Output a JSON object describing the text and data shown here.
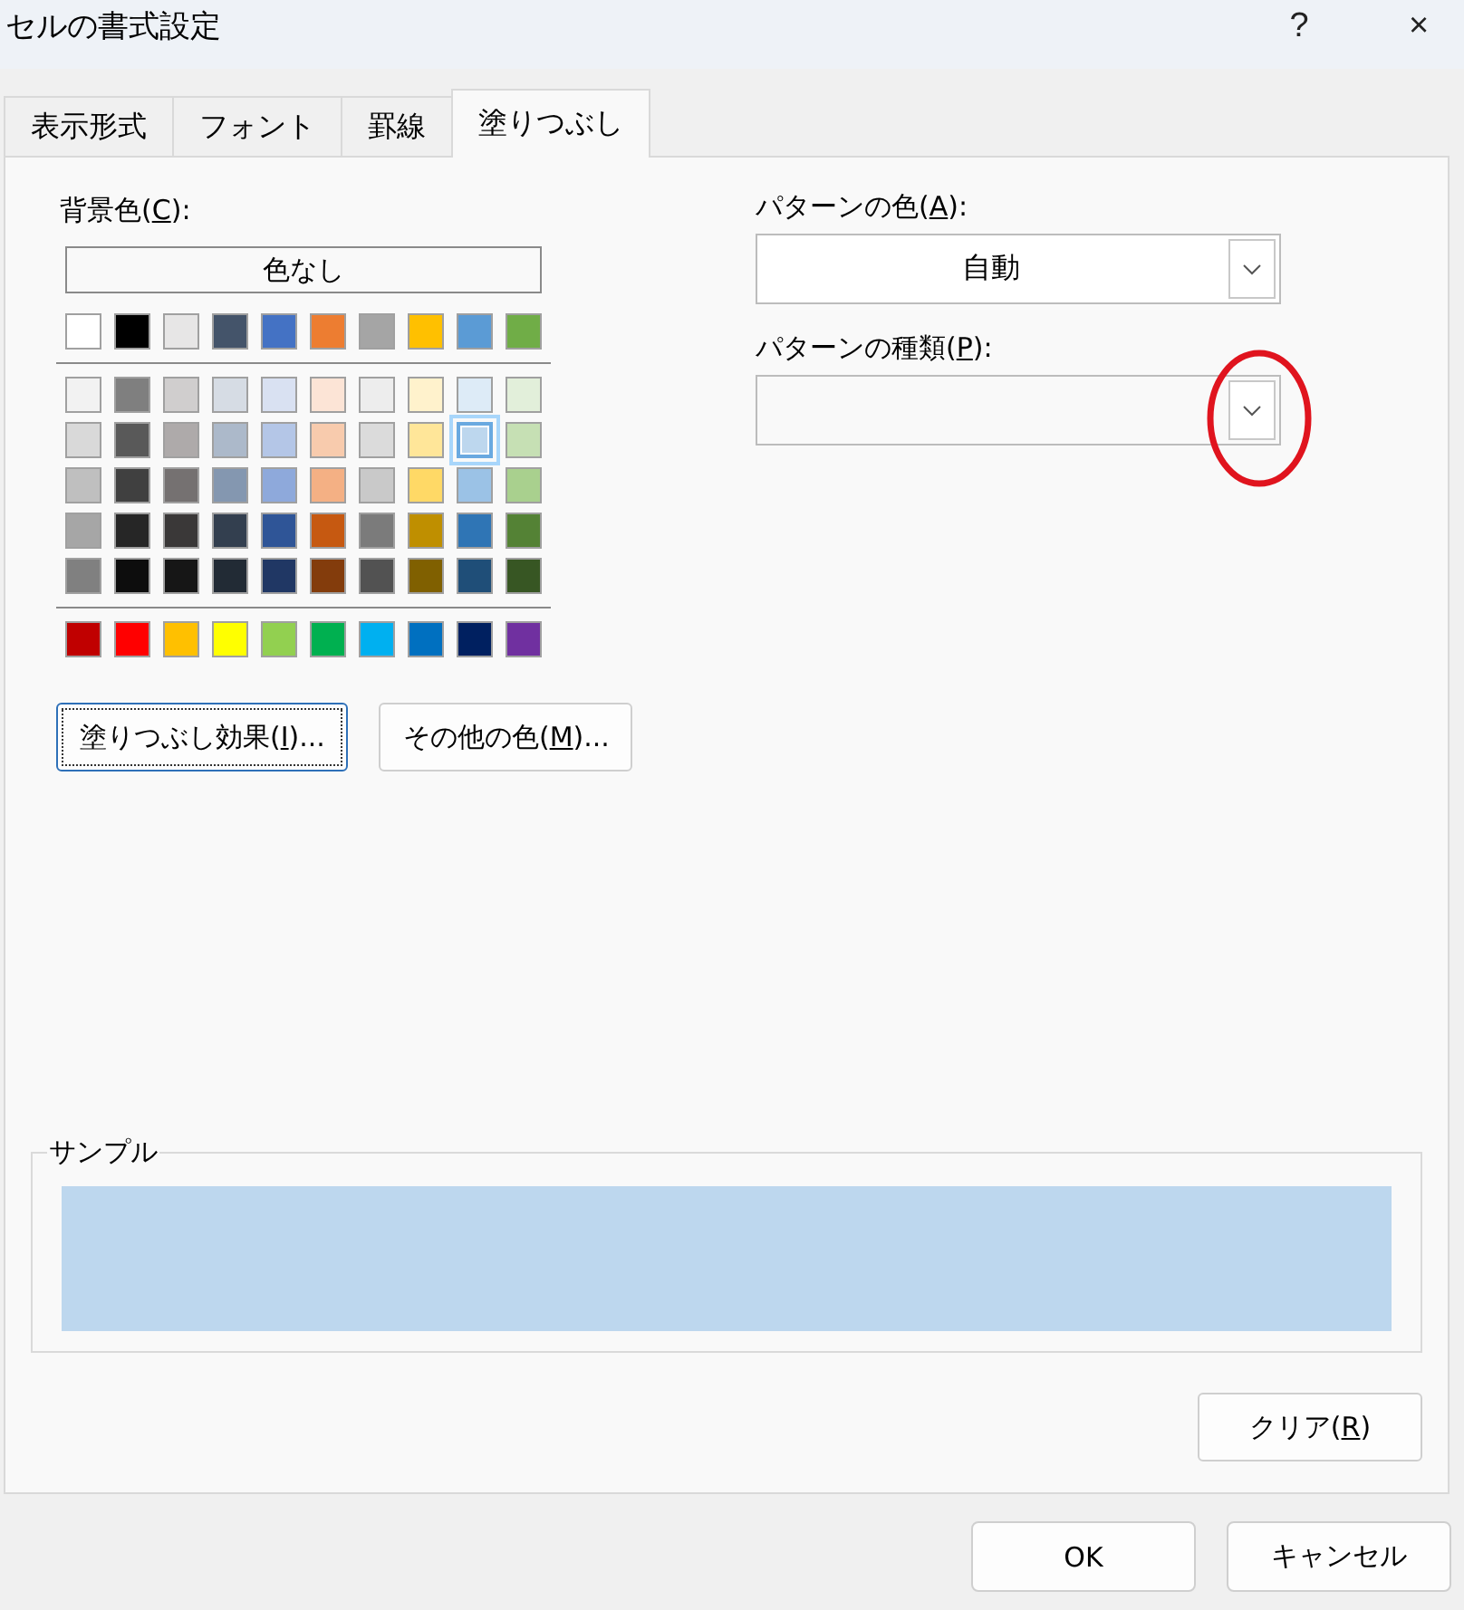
{
  "window": {
    "title": "セルの書式設定",
    "help": "?",
    "close": "×"
  },
  "tabs": [
    {
      "label": "表示形式",
      "selected": false
    },
    {
      "label": "フォント",
      "selected": false
    },
    {
      "label": "罫線",
      "selected": false
    },
    {
      "label": "塗りつぶし",
      "selected": true
    }
  ],
  "background_color": {
    "label": "背景色(C):",
    "access_key_underlined": true,
    "no_color_button": "色なし",
    "theme_colors": [
      {
        "color": "#ffffff",
        "selected": false
      },
      {
        "color": "#000000",
        "selected": false
      },
      {
        "color": "#e7e6e6",
        "selected": false
      },
      {
        "color": "#44546a",
        "selected": false
      },
      {
        "color": "#4472c4",
        "selected": false
      },
      {
        "color": "#ed7d31",
        "selected": false
      },
      {
        "color": "#a5a5a5",
        "selected": false
      },
      {
        "color": "#ffc000",
        "selected": false
      },
      {
        "color": "#5b9bd5",
        "selected": false
      },
      {
        "color": "#70ad47",
        "selected": false
      }
    ],
    "tint_rows": [
      {
        "swatches": [
          {
            "color": "#f2f2f2",
            "selected": false
          },
          {
            "color": "#7f7f7f",
            "selected": false
          },
          {
            "color": "#d0cece",
            "selected": false
          },
          {
            "color": "#d6dce4",
            "selected": false
          },
          {
            "color": "#d9e1f2",
            "selected": false
          },
          {
            "color": "#fce4d6",
            "selected": false
          },
          {
            "color": "#ededed",
            "selected": false
          },
          {
            "color": "#fff2cc",
            "selected": false
          },
          {
            "color": "#ddebf7",
            "selected": false
          },
          {
            "color": "#e2efda",
            "selected": false
          }
        ]
      },
      {
        "swatches": [
          {
            "color": "#d9d9d9",
            "selected": false
          },
          {
            "color": "#595959",
            "selected": false
          },
          {
            "color": "#aeaaaa",
            "selected": false
          },
          {
            "color": "#acb9ca",
            "selected": false
          },
          {
            "color": "#b4c6e7",
            "selected": false
          },
          {
            "color": "#f8cbad",
            "selected": false
          },
          {
            "color": "#dbdbdb",
            "selected": false
          },
          {
            "color": "#ffe699",
            "selected": false
          },
          {
            "color": "#bdd7ee",
            "selected": true
          },
          {
            "color": "#c6e0b4",
            "selected": false
          }
        ]
      },
      {
        "swatches": [
          {
            "color": "#bfbfbf",
            "selected": false
          },
          {
            "color": "#404040",
            "selected": false
          },
          {
            "color": "#757171",
            "selected": false
          },
          {
            "color": "#8497b0",
            "selected": false
          },
          {
            "color": "#8ea9db",
            "selected": false
          },
          {
            "color": "#f4b084",
            "selected": false
          },
          {
            "color": "#c9c9c9",
            "selected": false
          },
          {
            "color": "#ffd966",
            "selected": false
          },
          {
            "color": "#9bc2e6",
            "selected": false
          },
          {
            "color": "#a9d08e",
            "selected": false
          }
        ]
      },
      {
        "swatches": [
          {
            "color": "#a6a6a6",
            "selected": false
          },
          {
            "color": "#262626",
            "selected": false
          },
          {
            "color": "#3a3838",
            "selected": false
          },
          {
            "color": "#333f4f",
            "selected": false
          },
          {
            "color": "#2f5597",
            "selected": false
          },
          {
            "color": "#c65911",
            "selected": false
          },
          {
            "color": "#7b7b7b",
            "selected": false
          },
          {
            "color": "#bf8f00",
            "selected": false
          },
          {
            "color": "#2f75b5",
            "selected": false
          },
          {
            "color": "#548235",
            "selected": false
          }
        ]
      },
      {
        "swatches": [
          {
            "color": "#808080",
            "selected": false
          },
          {
            "color": "#0d0d0d",
            "selected": false
          },
          {
            "color": "#161616",
            "selected": false
          },
          {
            "color": "#222b35",
            "selected": false
          },
          {
            "color": "#203764",
            "selected": false
          },
          {
            "color": "#833c0c",
            "selected": false
          },
          {
            "color": "#525252",
            "selected": false
          },
          {
            "color": "#806000",
            "selected": false
          },
          {
            "color": "#1f4e78",
            "selected": false
          },
          {
            "color": "#375623",
            "selected": false
          }
        ]
      }
    ],
    "standard_colors": [
      {
        "color": "#c00000",
        "selected": false
      },
      {
        "color": "#ff0000",
        "selected": false
      },
      {
        "color": "#ffc000",
        "selected": false
      },
      {
        "color": "#ffff00",
        "selected": false
      },
      {
        "color": "#92d050",
        "selected": false
      },
      {
        "color": "#00b050",
        "selected": false
      },
      {
        "color": "#00b0f0",
        "selected": false
      },
      {
        "color": "#0070c0",
        "selected": false
      },
      {
        "color": "#002060",
        "selected": false
      },
      {
        "color": "#7030a0",
        "selected": false
      }
    ],
    "buttons": [
      {
        "label": "塗りつぶし効果(I)...",
        "access_key_underlined": true,
        "focused": true
      },
      {
        "label": "その他の色(M)...",
        "access_key_underlined": true,
        "focused": false
      }
    ]
  },
  "pattern_color": {
    "label": "パターンの色(A):",
    "access_key_underlined": true,
    "value": "自動"
  },
  "pattern_style": {
    "label": "パターンの種類(P):",
    "access_key_underlined": true
  },
  "annotation": {
    "kind": "ellipse",
    "color": "#e0141e"
  },
  "sample": {
    "label": "サンプル",
    "color": "#bdd7ee"
  },
  "clear_button": {
    "label": "クリア(R)",
    "access_key_underlined": true
  },
  "footer_buttons": [
    {
      "label": "OK"
    },
    {
      "label": "キャンセル"
    }
  ]
}
